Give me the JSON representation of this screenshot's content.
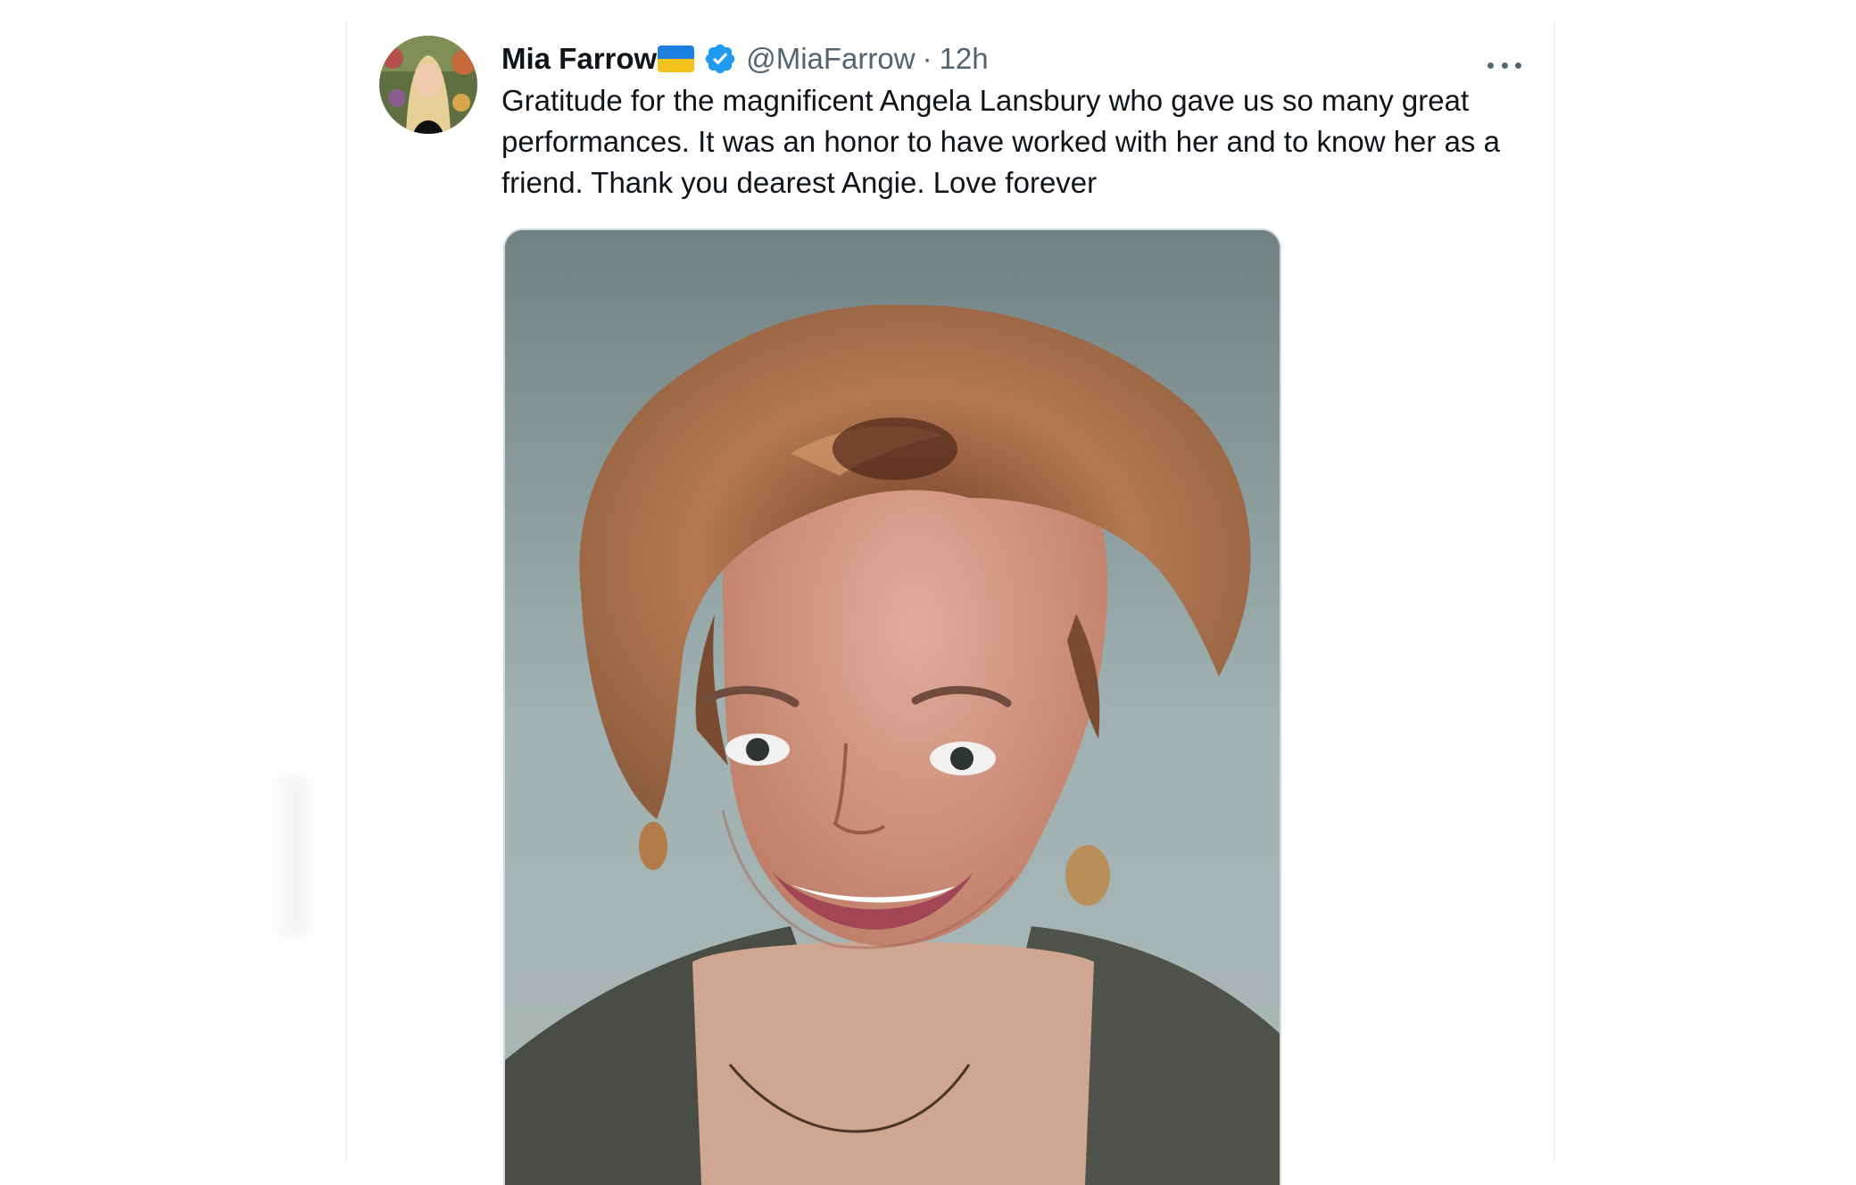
{
  "tweet": {
    "display_name": "Mia Farrow",
    "handle": "@MiaFarrow",
    "separator": "·",
    "time": "12h",
    "text": "Gratitude for the magnificent Angela Lansbury who gave us so many great performances. It was an honor to have worked with her and to know her as a friend. Thank you dearest Angie. Love forever",
    "flag_icon": "ukraine-flag-icon",
    "verified_icon": "verified-badge-icon",
    "more_icon": "more-options-icon",
    "verified_color": "#1d9bf0"
  }
}
